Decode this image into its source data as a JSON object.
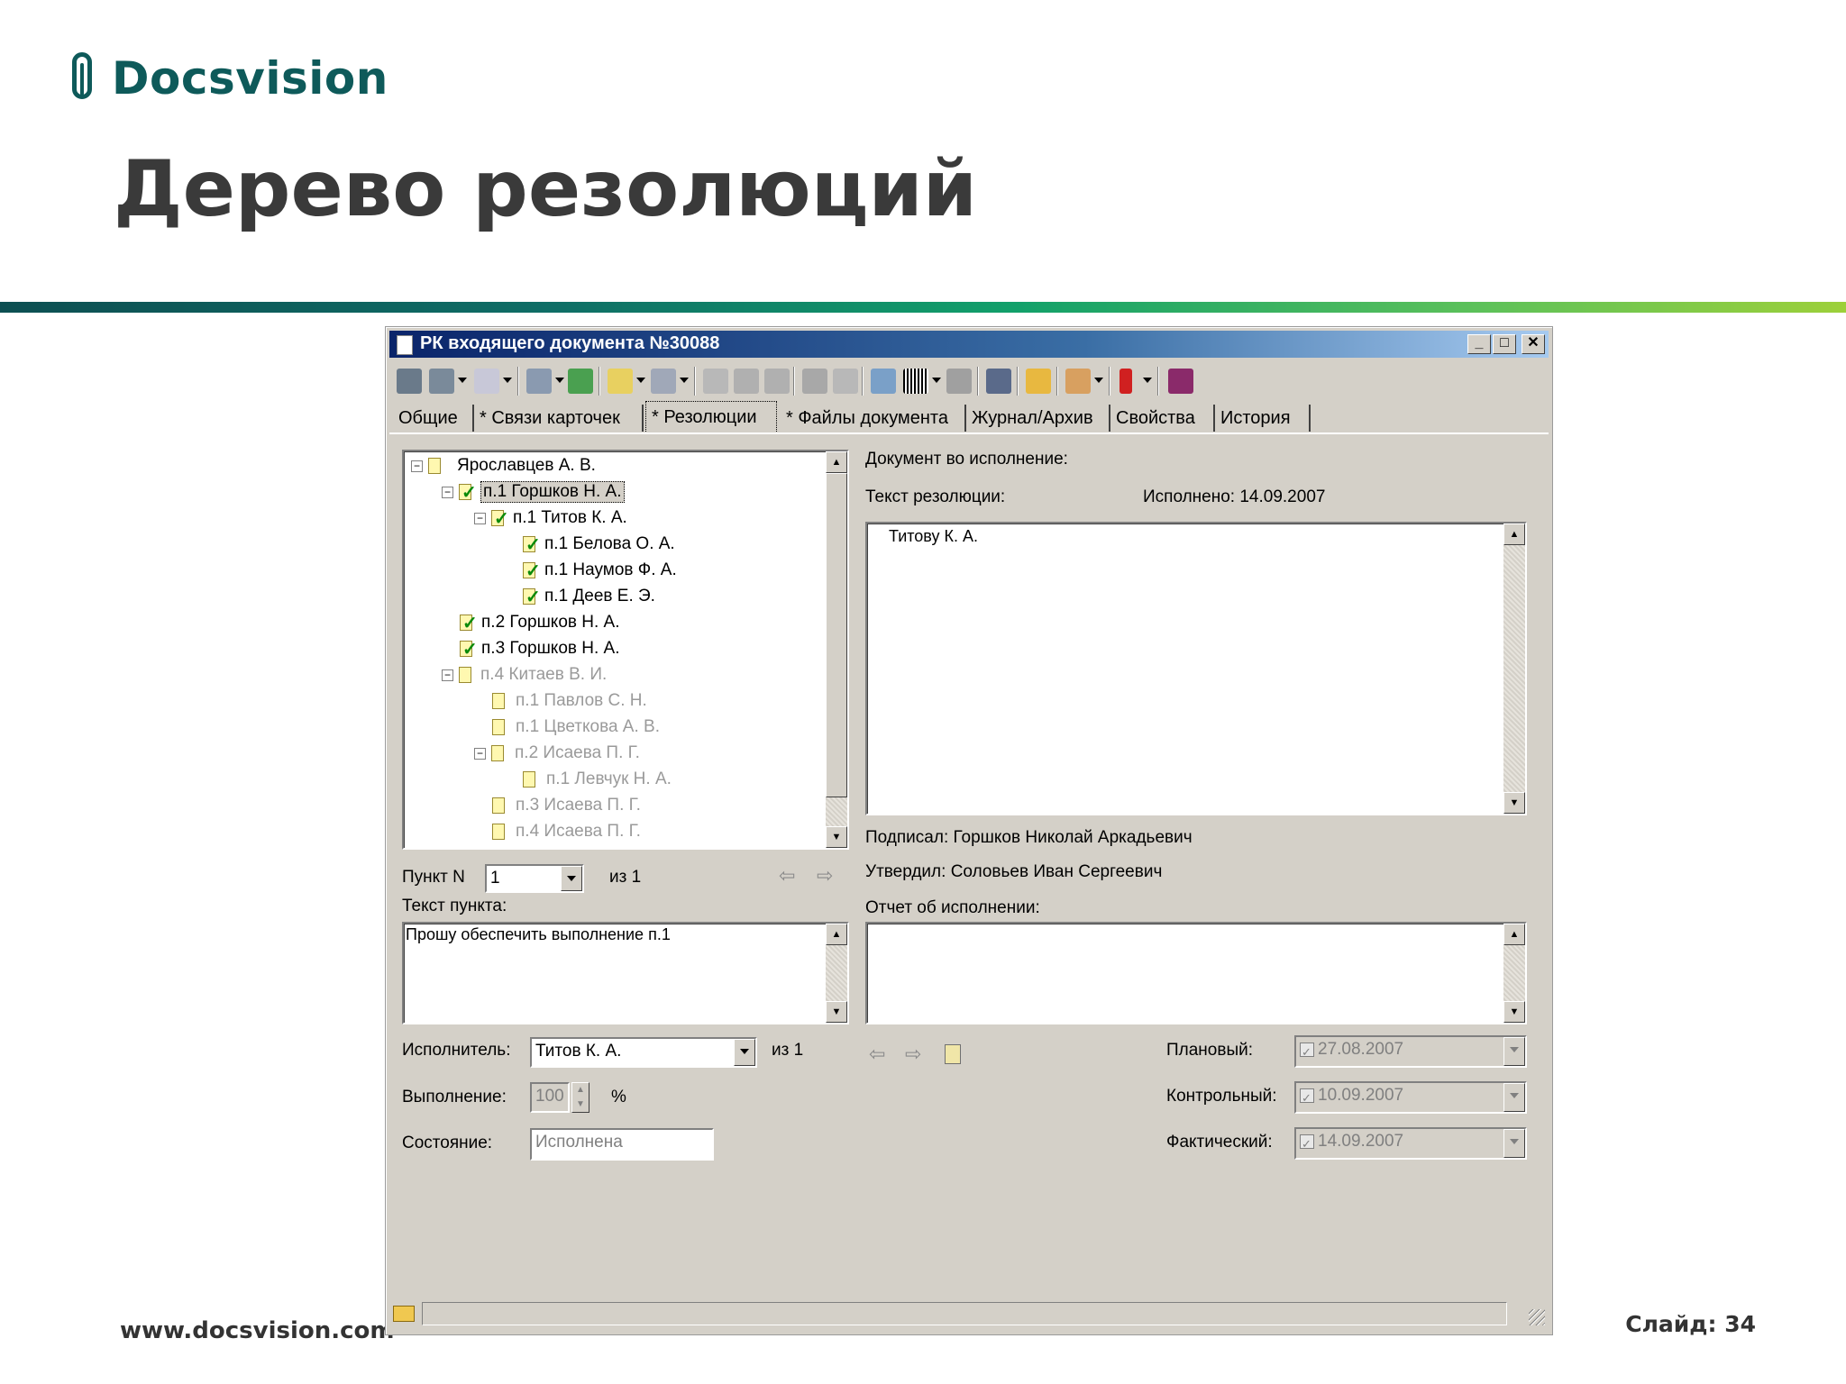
{
  "slide": {
    "logo_text": "Docsvision",
    "title": "Дерево резолюций",
    "footer_url": "www.docsvision.com",
    "slide_number": "Слайд: 34"
  },
  "window": {
    "title": "РК входящего документа №30088",
    "controls": {
      "minimize": "_",
      "maximize": "□",
      "close": "✕"
    }
  },
  "toolbar_icons": [
    "save-icon",
    "save-as-icon",
    "email-icon",
    "print-preview-icon",
    "forward-icon",
    "copy-icon",
    "approve-icon",
    "sign-icon",
    "undo-icon",
    "redo-icon",
    "edit-icon",
    "paste-icon",
    "stamp-icon",
    "barcode-icon",
    "print-icon",
    "scan-icon",
    "folder-up-icon",
    "users-icon",
    "flag-icon",
    "book-icon"
  ],
  "tabs": [
    {
      "label": "Общие"
    },
    {
      "label": "* Связи карточек"
    },
    {
      "label": "* Резолюции"
    },
    {
      "label": "* Файлы документа"
    },
    {
      "label": "Журнал/Архив"
    },
    {
      "label": "Свойства"
    },
    {
      "label": "История"
    }
  ],
  "tree": [
    {
      "label": "Ярославцев А. В."
    },
    {
      "label": "п.1 Горшков Н. А."
    },
    {
      "label": "п.1 Титов К. А."
    },
    {
      "label": "п.1 Белова О. А."
    },
    {
      "label": "п.1 Наумов Ф. А."
    },
    {
      "label": "п.1 Деев Е. Э."
    },
    {
      "label": "п.2 Горшков Н. А."
    },
    {
      "label": "п.3 Горшков Н. А."
    },
    {
      "label": "п.4 Китаев В. И."
    },
    {
      "label": "п.1 Павлов С. Н."
    },
    {
      "label": "п.1 Цветкова А. В."
    },
    {
      "label": "п.2 Исаева П. Г."
    },
    {
      "label": "п.1 Левчук Н. А."
    },
    {
      "label": "п.3 Исаева П. Г."
    },
    {
      "label": "п.4 Исаева П. Г."
    }
  ],
  "left": {
    "punkt_label": "Пункт N",
    "punkt_value": "1",
    "punkt_of": "из 1",
    "punkt_text_label": "Текст пункта:",
    "punkt_text": "Прошу обеспечить выполнение п.1",
    "executor_label": "Исполнитель:",
    "executor_value": "Титов К. А.",
    "executor_of": "из 1",
    "execution_label": "Выполнение:",
    "execution_value": "100",
    "execution_unit": "%",
    "state_label": "Состояние:",
    "state_value": "Исполнена"
  },
  "right": {
    "doc_label": "Документ во исполнение:",
    "resolution_text_label": "Текст резолюции:",
    "executed": "Исполнено: 14.09.2007",
    "resolution_text": "Титову К. А.",
    "signed": "Подписал: Горшков Николай Аркадьевич",
    "approved": "Утвердил:  Соловьев Иван Сергеевич",
    "report_label": "Отчет об исполнении:",
    "report_text": "",
    "planned_label": "Плановый:",
    "planned_value": "27.08.2007",
    "control_label": "Контрольный:",
    "control_value": "10.09.2007",
    "actual_label": "Фактический:",
    "actual_value": "14.09.2007"
  },
  "colors": {
    "titlebar": "#0a246a",
    "window_bg": "#d4d0c8",
    "brand": "#0e5a5a"
  }
}
